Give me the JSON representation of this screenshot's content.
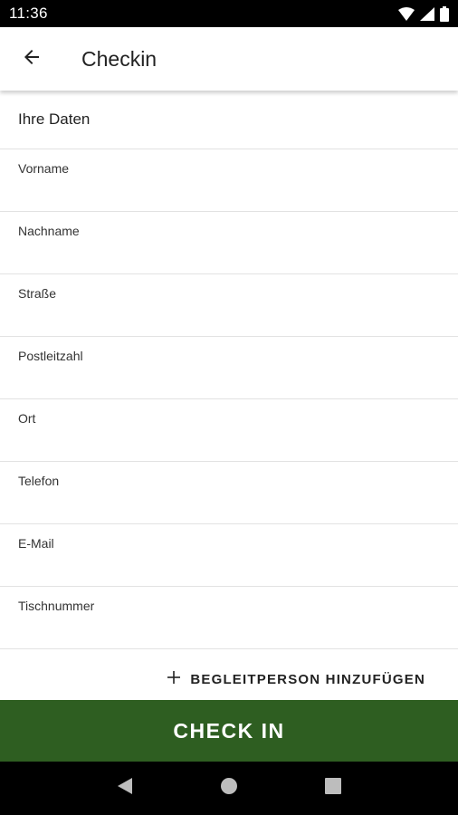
{
  "status_bar": {
    "time": "11:36",
    "icons": [
      "wifi-icon",
      "signal-icon",
      "battery-icon"
    ]
  },
  "app_bar": {
    "back_icon": "arrow-left-icon",
    "title": "Checkin"
  },
  "form": {
    "section_title": "Ihre Daten",
    "fields": [
      {
        "label": "Vorname",
        "value": ""
      },
      {
        "label": "Nachname",
        "value": ""
      },
      {
        "label": "Straße",
        "value": ""
      },
      {
        "label": "Postleitzahl",
        "value": ""
      },
      {
        "label": "Ort",
        "value": ""
      },
      {
        "label": "Telefon",
        "value": ""
      },
      {
        "label": "E-Mail",
        "value": ""
      },
      {
        "label": "Tischnummer",
        "value": ""
      }
    ],
    "add_companion_label": "BEGLEITPERSON HINZUFÜGEN",
    "add_companion_icon": "plus-icon"
  },
  "checkin_button": {
    "label": "CHECK IN",
    "color": "#2e5e21"
  },
  "nav_bar": {
    "buttons": [
      "back-triangle-icon",
      "home-circle-icon",
      "recents-square-icon"
    ]
  }
}
